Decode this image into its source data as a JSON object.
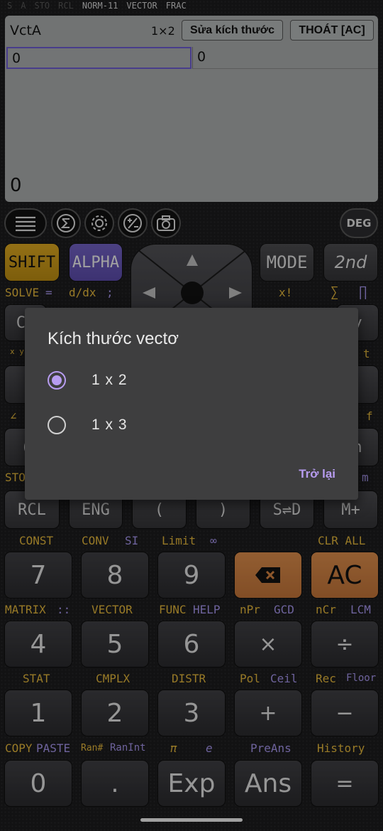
{
  "status": {
    "indicators_dim": [
      "S",
      "A",
      "STO",
      "RCL"
    ],
    "indicators": [
      "NORM-11",
      "VECTOR",
      "FRAC"
    ]
  },
  "screen": {
    "title": "VctA",
    "dimension": "1×2",
    "edit_size_label": "Sửa kích thước",
    "exit_label": "THOÁT [AC]",
    "cells": [
      "0",
      "0"
    ],
    "result": "0"
  },
  "toolbar": {
    "icons": [
      "menu-icon",
      "sigma-icon",
      "settings-icon",
      "plus-minus-icon",
      "camera-icon"
    ],
    "deg_label": "DEG"
  },
  "top_keys": {
    "shift": "SHIFT",
    "alpha": "ALPHA",
    "mode": "MODE",
    "second": "2nd"
  },
  "labels_row1": {
    "solve": "SOLVE",
    "eq": "=",
    "ddx": "d/dx",
    "semi": ";",
    "fact": "x!",
    "sum": "∑",
    "prod": "∏"
  },
  "hidden_keys": {
    "left1": "CA",
    "right1": "y",
    "left2": "(",
    "right2": "n",
    "sto": "STO",
    "xyz": "x y z",
    "angle": "∠",
    "t": "t",
    "f": "f",
    "m": "m"
  },
  "row_rcl": {
    "keys": [
      "RCL",
      "ENG",
      "(",
      ")",
      "S⇌D",
      "M+"
    ]
  },
  "labels_const": {
    "const": "CONST",
    "conv": "CONV",
    "si": "SI",
    "limit": "Limit",
    "inf": "∞",
    "clr_all": "CLR ALL"
  },
  "row_789": {
    "keys": [
      "7",
      "8",
      "9",
      "⌫",
      "AC"
    ]
  },
  "labels_matrix": {
    "matrix": "MATRIX",
    "matrix_sym": "::",
    "vector": "VECTOR",
    "func": "FUNC",
    "help": "HELP",
    "npr": "nPr",
    "gcd": "GCD",
    "ncr": "nCr",
    "lcm": "LCM"
  },
  "row_456": {
    "keys": [
      "4",
      "5",
      "6",
      "×",
      "÷"
    ]
  },
  "labels_stat": {
    "stat": "STAT",
    "cmplx": "CMPLX",
    "distr": "DISTR",
    "pol": "Pol",
    "ceil": "Ceil",
    "rec": "Rec",
    "floor": "Floor"
  },
  "row_123": {
    "keys": [
      "1",
      "2",
      "3",
      "+",
      "−"
    ]
  },
  "labels_copy": {
    "copy": "COPY",
    "paste": "PASTE",
    "ran": "Ran#",
    "ranint": "RanInt",
    "pi": "π",
    "e": "e",
    "preans": "PreAns",
    "history": "History"
  },
  "row_0": {
    "keys": [
      "0",
      ".",
      "Exp",
      "Ans",
      "="
    ]
  },
  "dialog": {
    "title": "Kích thước vectơ",
    "options": [
      "1 x 2",
      "1 x 3"
    ],
    "selected_index": 0,
    "back_label": "Trở lại"
  },
  "colors": {
    "shift": "#d9a520",
    "alpha": "#6a5ab8",
    "accent": "#b79cf0",
    "orange_key": "#d08040",
    "screen_bg": "#a7aaaa"
  }
}
